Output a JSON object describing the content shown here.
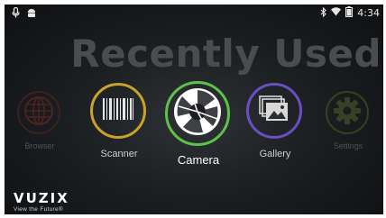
{
  "status_bar": {
    "left_icons": [
      "mic-icon",
      "android-icon"
    ],
    "right_icons": [
      "bluetooth-icon",
      "wifi-icon",
      "battery-icon"
    ],
    "time": "4:34"
  },
  "heading": "Recently Used",
  "apps": [
    {
      "label": "Browser",
      "icon": "globe-icon",
      "ring_color": "#7a2a22",
      "state": "dimmed"
    },
    {
      "label": "Scanner",
      "icon": "barcode-icon",
      "ring_color": "#c9a227",
      "state": "normal"
    },
    {
      "label": "Camera",
      "icon": "aperture-icon",
      "ring_color": "#5cc24a",
      "state": "selected"
    },
    {
      "label": "Gallery",
      "icon": "image-stack-icon",
      "ring_color": "#6a4fc2",
      "state": "normal"
    },
    {
      "label": "Settings",
      "icon": "gear-icon",
      "ring_color": "#5e6d1f",
      "state": "dimmed"
    }
  ],
  "logo": {
    "brand": "VUZIX",
    "tagline": "View the Future®"
  }
}
